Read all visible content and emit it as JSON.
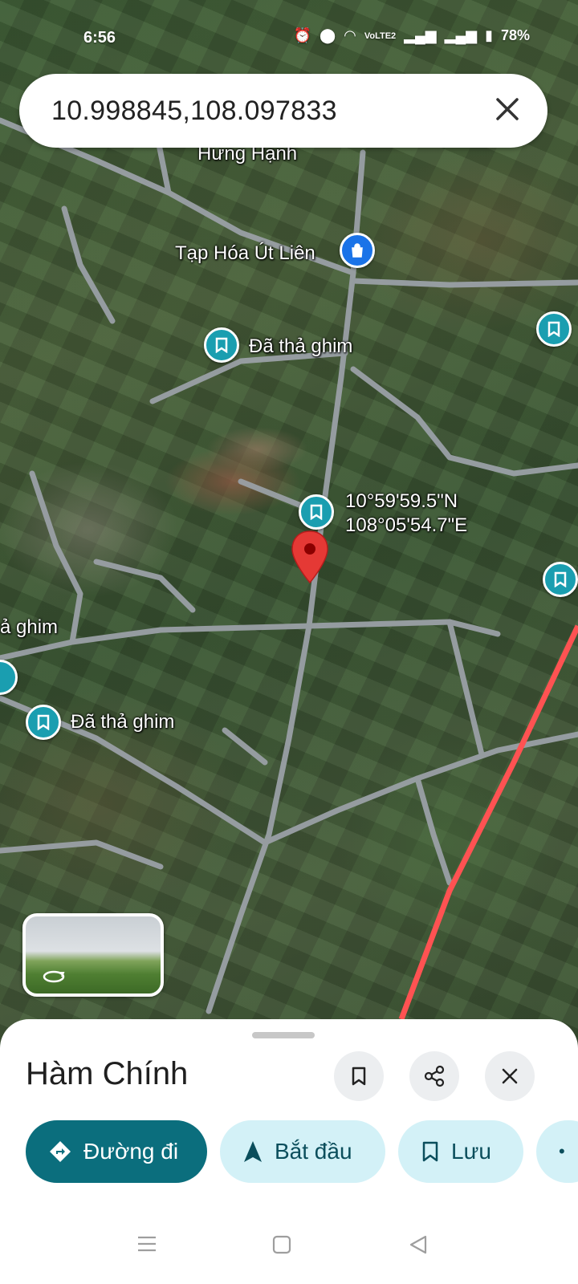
{
  "status_bar": {
    "time": "6:56",
    "network_label": "VoLTE2",
    "battery": "78%"
  },
  "search": {
    "query": "10.998845,108.097833"
  },
  "map": {
    "labels": {
      "partial_top": "Hưng Hạnh",
      "shop": "Tạp Hóa Út Liên",
      "pin_1": "Đã thả ghim",
      "pin_left_partial": "ả ghim",
      "pin_2": "Đã thả ghim",
      "coord_lat": "10°59'59.5\"N",
      "coord_lng": "108°05'54.7\"E"
    },
    "colors": {
      "saved_pin": "#1a9eb0",
      "shop_pin": "#1a73e8",
      "dropped_marker": "#e53935",
      "boundary_line": "#ff5252"
    }
  },
  "place": {
    "title": "Hàm Chính"
  },
  "actions": {
    "directions": "Đường đi",
    "start": "Bắt đầu",
    "save": "Lưu"
  },
  "icons": {
    "save": "bookmark-icon",
    "share": "share-icon",
    "close": "close-icon",
    "directions": "directions-icon",
    "start": "navigation-arrow-icon",
    "street_view": "street-view-rotate-icon"
  }
}
